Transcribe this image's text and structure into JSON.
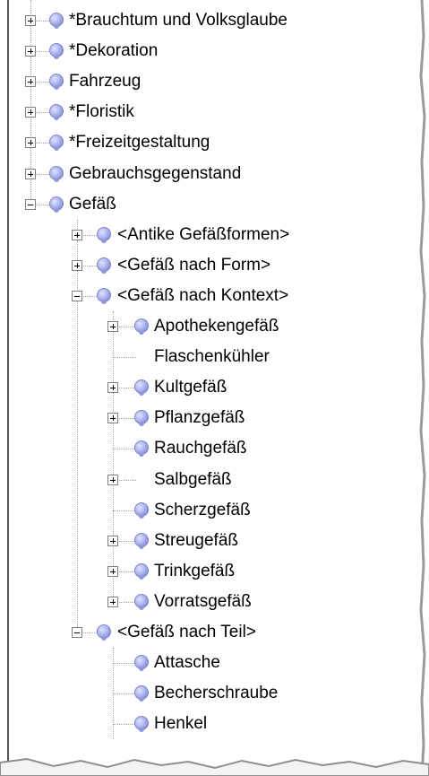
{
  "tree": {
    "items": [
      {
        "label": "*Brauchtum und Volksglaube",
        "level": 0,
        "expander": "plus",
        "icon": true
      },
      {
        "label": "*Dekoration",
        "level": 0,
        "expander": "plus",
        "icon": true
      },
      {
        "label": "Fahrzeug",
        "level": 0,
        "expander": "plus",
        "icon": true
      },
      {
        "label": "*Floristik",
        "level": 0,
        "expander": "plus",
        "icon": true
      },
      {
        "label": "*Freizeitgestaltung",
        "level": 0,
        "expander": "plus",
        "icon": true
      },
      {
        "label": "Gebrauchsgegenstand",
        "level": 0,
        "expander": "plus",
        "icon": true
      },
      {
        "label": "Gefäß",
        "level": 0,
        "expander": "minus",
        "icon": true
      },
      {
        "label": "<Antike Gefäßformen>",
        "level": 1,
        "expander": "plus",
        "icon": true
      },
      {
        "label": "<Gefäß nach Form>",
        "level": 1,
        "expander": "plus",
        "icon": true
      },
      {
        "label": "<Gefäß nach Kontext>",
        "level": 1,
        "expander": "minus",
        "icon": true
      },
      {
        "label": "Apothekengefäß",
        "level": 2,
        "expander": "plus",
        "icon": true
      },
      {
        "label": "Flaschenkühler",
        "level": 2,
        "expander": "none",
        "icon": false
      },
      {
        "label": "Kultgefäß",
        "level": 2,
        "expander": "plus",
        "icon": true
      },
      {
        "label": "Pflanzgefäß",
        "level": 2,
        "expander": "plus",
        "icon": true
      },
      {
        "label": "Rauchgefäß",
        "level": 2,
        "expander": "none",
        "icon": true
      },
      {
        "label": "Salbgefäß",
        "level": 2,
        "expander": "plus",
        "icon": false
      },
      {
        "label": "Scherzgefäß",
        "level": 2,
        "expander": "none",
        "icon": true
      },
      {
        "label": "Streugefäß",
        "level": 2,
        "expander": "plus",
        "icon": true
      },
      {
        "label": "Trinkgefäß",
        "level": 2,
        "expander": "plus",
        "icon": true
      },
      {
        "label": "Vorratsgefäß",
        "level": 2,
        "expander": "plus",
        "icon": true
      },
      {
        "label": "<Gefäß nach Teil>",
        "level": 1,
        "expander": "minus",
        "icon": true
      },
      {
        "label": "Attasche",
        "level": 2,
        "expander": "none",
        "icon": true
      },
      {
        "label": "Becherschraube",
        "level": 2,
        "expander": "none",
        "icon": true
      },
      {
        "label": "Henkel",
        "level": 2,
        "expander": "none",
        "icon": true
      }
    ]
  }
}
